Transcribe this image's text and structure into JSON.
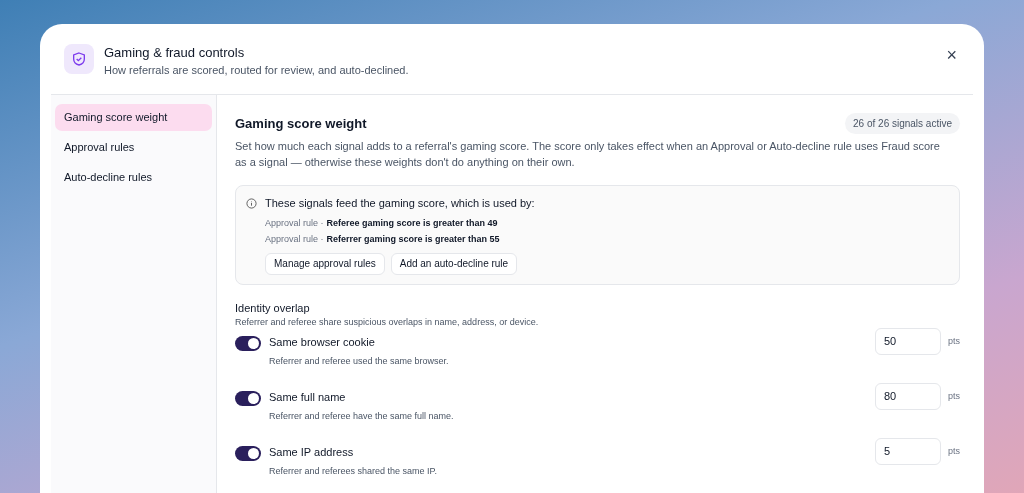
{
  "dialog": {
    "title": "Gaming & fraud controls",
    "subtitle": "How referrals are scored, routed for review, and auto-declined.",
    "close": "×"
  },
  "sidebar": {
    "items": [
      {
        "label": "Gaming score weight",
        "selected": true
      },
      {
        "label": "Approval rules",
        "selected": false
      },
      {
        "label": "Auto-decline rules",
        "selected": false
      }
    ]
  },
  "section": {
    "title": "Gaming score weight",
    "badge": "26 of 26 signals active",
    "description": "Set how much each signal adds to a referral's gaming score. The score only takes effect when an Approval or Auto-decline rule uses Fraud score as a signal — otherwise these weights don't do anything on their own."
  },
  "notice": {
    "text": "These signals feed the gaming score, which is used by:",
    "rules": [
      {
        "type": "Approval rule ·",
        "condition": "Referee gaming score is greater than 49"
      },
      {
        "type": "Approval rule ·",
        "condition": "Referrer gaming score is greater than 55"
      }
    ],
    "buttons": [
      "Manage approval rules",
      "Add an auto-decline rule"
    ]
  },
  "group": {
    "title": "Identity overlap",
    "description": "Referrer and referee share suspicious overlaps in name, address, or device.",
    "signals": [
      {
        "name": "Same browser cookie",
        "description": "Referrer and referee used the same browser.",
        "on": true,
        "points": "50",
        "unit": "pts"
      },
      {
        "name": "Same full name",
        "description": "Referrer and referee have the same full name.",
        "on": true,
        "points": "80",
        "unit": "pts"
      },
      {
        "name": "Same IP address",
        "description": "Referrer and referees shared the same IP.",
        "on": true,
        "points": "5",
        "unit": "pts"
      }
    ]
  }
}
